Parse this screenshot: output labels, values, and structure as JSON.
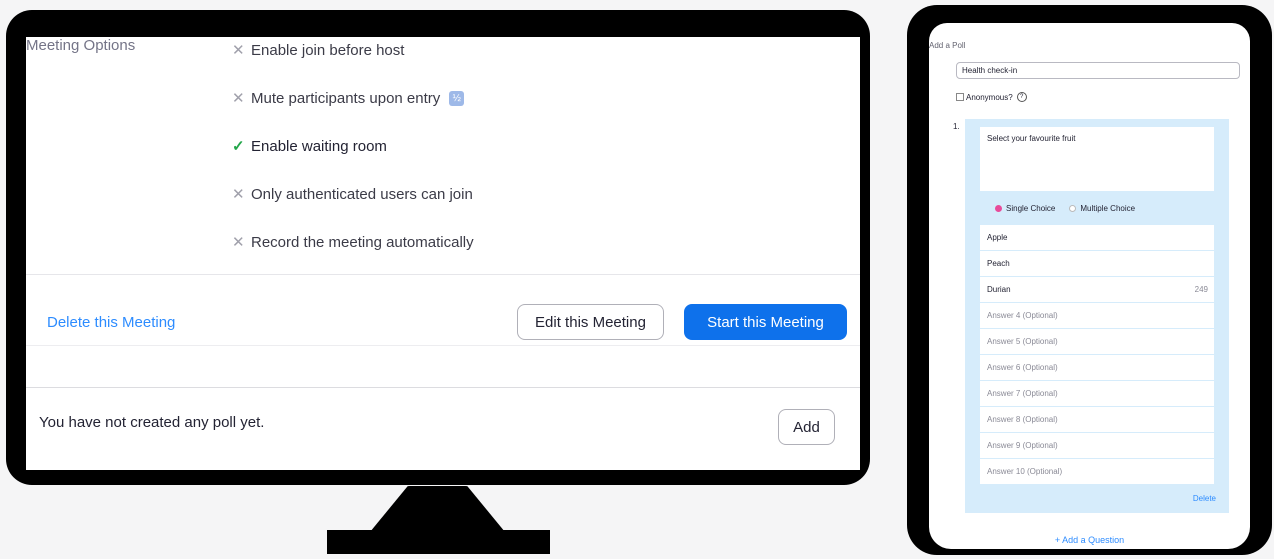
{
  "meeting": {
    "options_title": "Meeting Options",
    "options": [
      {
        "label": "Enable join before host",
        "enabled": false
      },
      {
        "label": "Mute participants upon entry",
        "enabled": false
      },
      {
        "label": "Enable waiting room",
        "enabled": true
      },
      {
        "label": "Only authenticated users can join",
        "enabled": false
      },
      {
        "label": "Record the meeting automatically",
        "enabled": false
      }
    ],
    "delete_label": "Delete this Meeting",
    "edit_label": "Edit this Meeting",
    "start_label": "Start this Meeting",
    "no_poll_text": "You have not created any poll yet.",
    "add_label": "Add"
  },
  "poll": {
    "header": "Add a Poll",
    "title_value": "Health check-in",
    "anonymous_label": "Anonymous?",
    "question_number": "1.",
    "question_text": "Select your favourite fruit",
    "single_choice_label": "Single Choice",
    "multiple_choice_label": "Multiple Choice",
    "answers": [
      {
        "text": "Apple",
        "placeholder": false
      },
      {
        "text": "Peach",
        "placeholder": false
      },
      {
        "text": "Durian",
        "placeholder": false,
        "count": "249"
      },
      {
        "text": "Answer 4 (Optional)",
        "placeholder": true
      },
      {
        "text": "Answer 5 (Optional)",
        "placeholder": true
      },
      {
        "text": "Answer 6 (Optional)",
        "placeholder": true
      },
      {
        "text": "Answer 7 (Optional)",
        "placeholder": true
      },
      {
        "text": "Answer 8 (Optional)",
        "placeholder": true
      },
      {
        "text": "Answer 9 (Optional)",
        "placeholder": true
      },
      {
        "text": "Answer 10 (Optional)",
        "placeholder": true
      }
    ],
    "delete_label": "Delete",
    "add_question_label": "+ Add a Question"
  },
  "colors": {
    "accent_blue": "#0e71eb",
    "link_blue": "#2d8cff",
    "check_green": "#23a64a",
    "panel_blue": "#d6ecfb",
    "radio_pink": "#e84b9a"
  }
}
